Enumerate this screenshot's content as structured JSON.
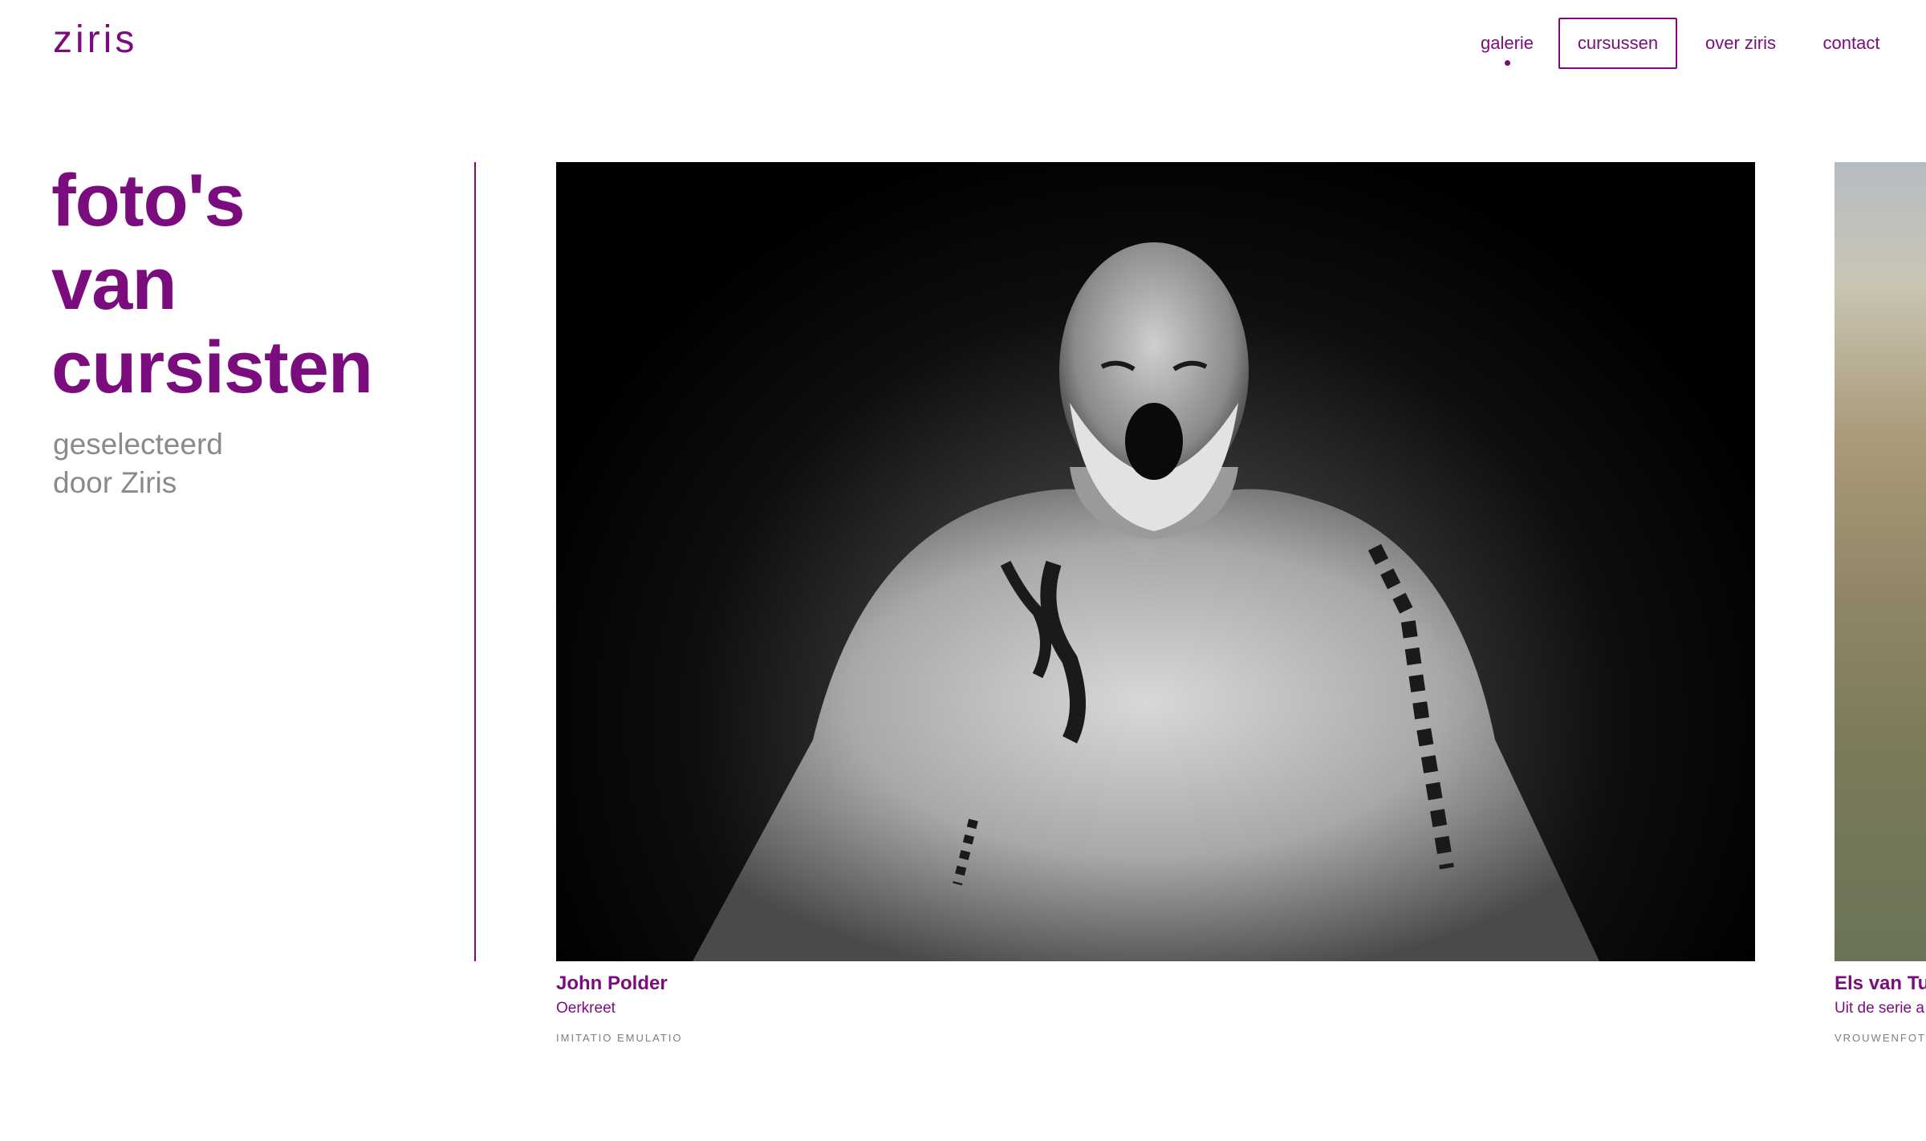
{
  "header": {
    "logo": "ziris",
    "nav": [
      {
        "label": "galerie",
        "active": true
      },
      {
        "label": "cursussen",
        "active": false
      },
      {
        "label": "over ziris",
        "active": false
      },
      {
        "label": "contact",
        "active": false
      }
    ]
  },
  "intro": {
    "heading_lines": [
      "foto's",
      "van",
      "cursisten"
    ],
    "sub_lines": [
      "geselecteerd",
      "door Ziris"
    ]
  },
  "gallery": [
    {
      "name": "John Polder",
      "title": "Oerkreet",
      "course": "IMITATIO EMULATIO",
      "image": "black-and-white portrait of tattooed man screaming"
    },
    {
      "name": "Els van Tu",
      "title": "Uit de serie a",
      "course": "VROUWENFOTO",
      "image": "rocky cliff landscape (cropped)"
    }
  ],
  "colors": {
    "accent": "#7a0c7e",
    "muted": "#8a8a8a",
    "background": "#ffffff"
  }
}
